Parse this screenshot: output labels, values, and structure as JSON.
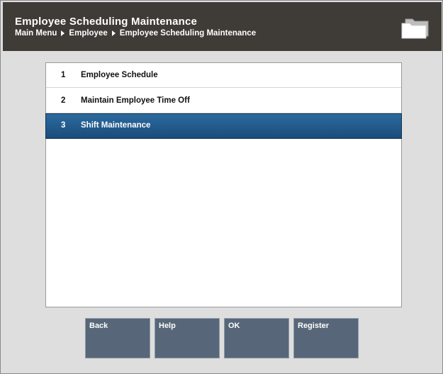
{
  "header": {
    "title": "Employee Scheduling Maintenance",
    "breadcrumb": [
      "Main Menu",
      "Employee",
      "Employee Scheduling Maintenance"
    ],
    "icon": "folder-icon"
  },
  "menu": {
    "items": [
      {
        "number": "1",
        "label": "Employee Schedule",
        "selected": false
      },
      {
        "number": "2",
        "label": "Maintain Employee Time Off",
        "selected": false
      },
      {
        "number": "3",
        "label": "Shift Maintenance",
        "selected": true
      }
    ]
  },
  "buttons": {
    "back": "Back",
    "help": "Help",
    "ok": "OK",
    "register": "Register"
  },
  "colors": {
    "header_bg": "#3f3b37",
    "selected_row": "#1f5585",
    "button_bg": "#576779"
  }
}
